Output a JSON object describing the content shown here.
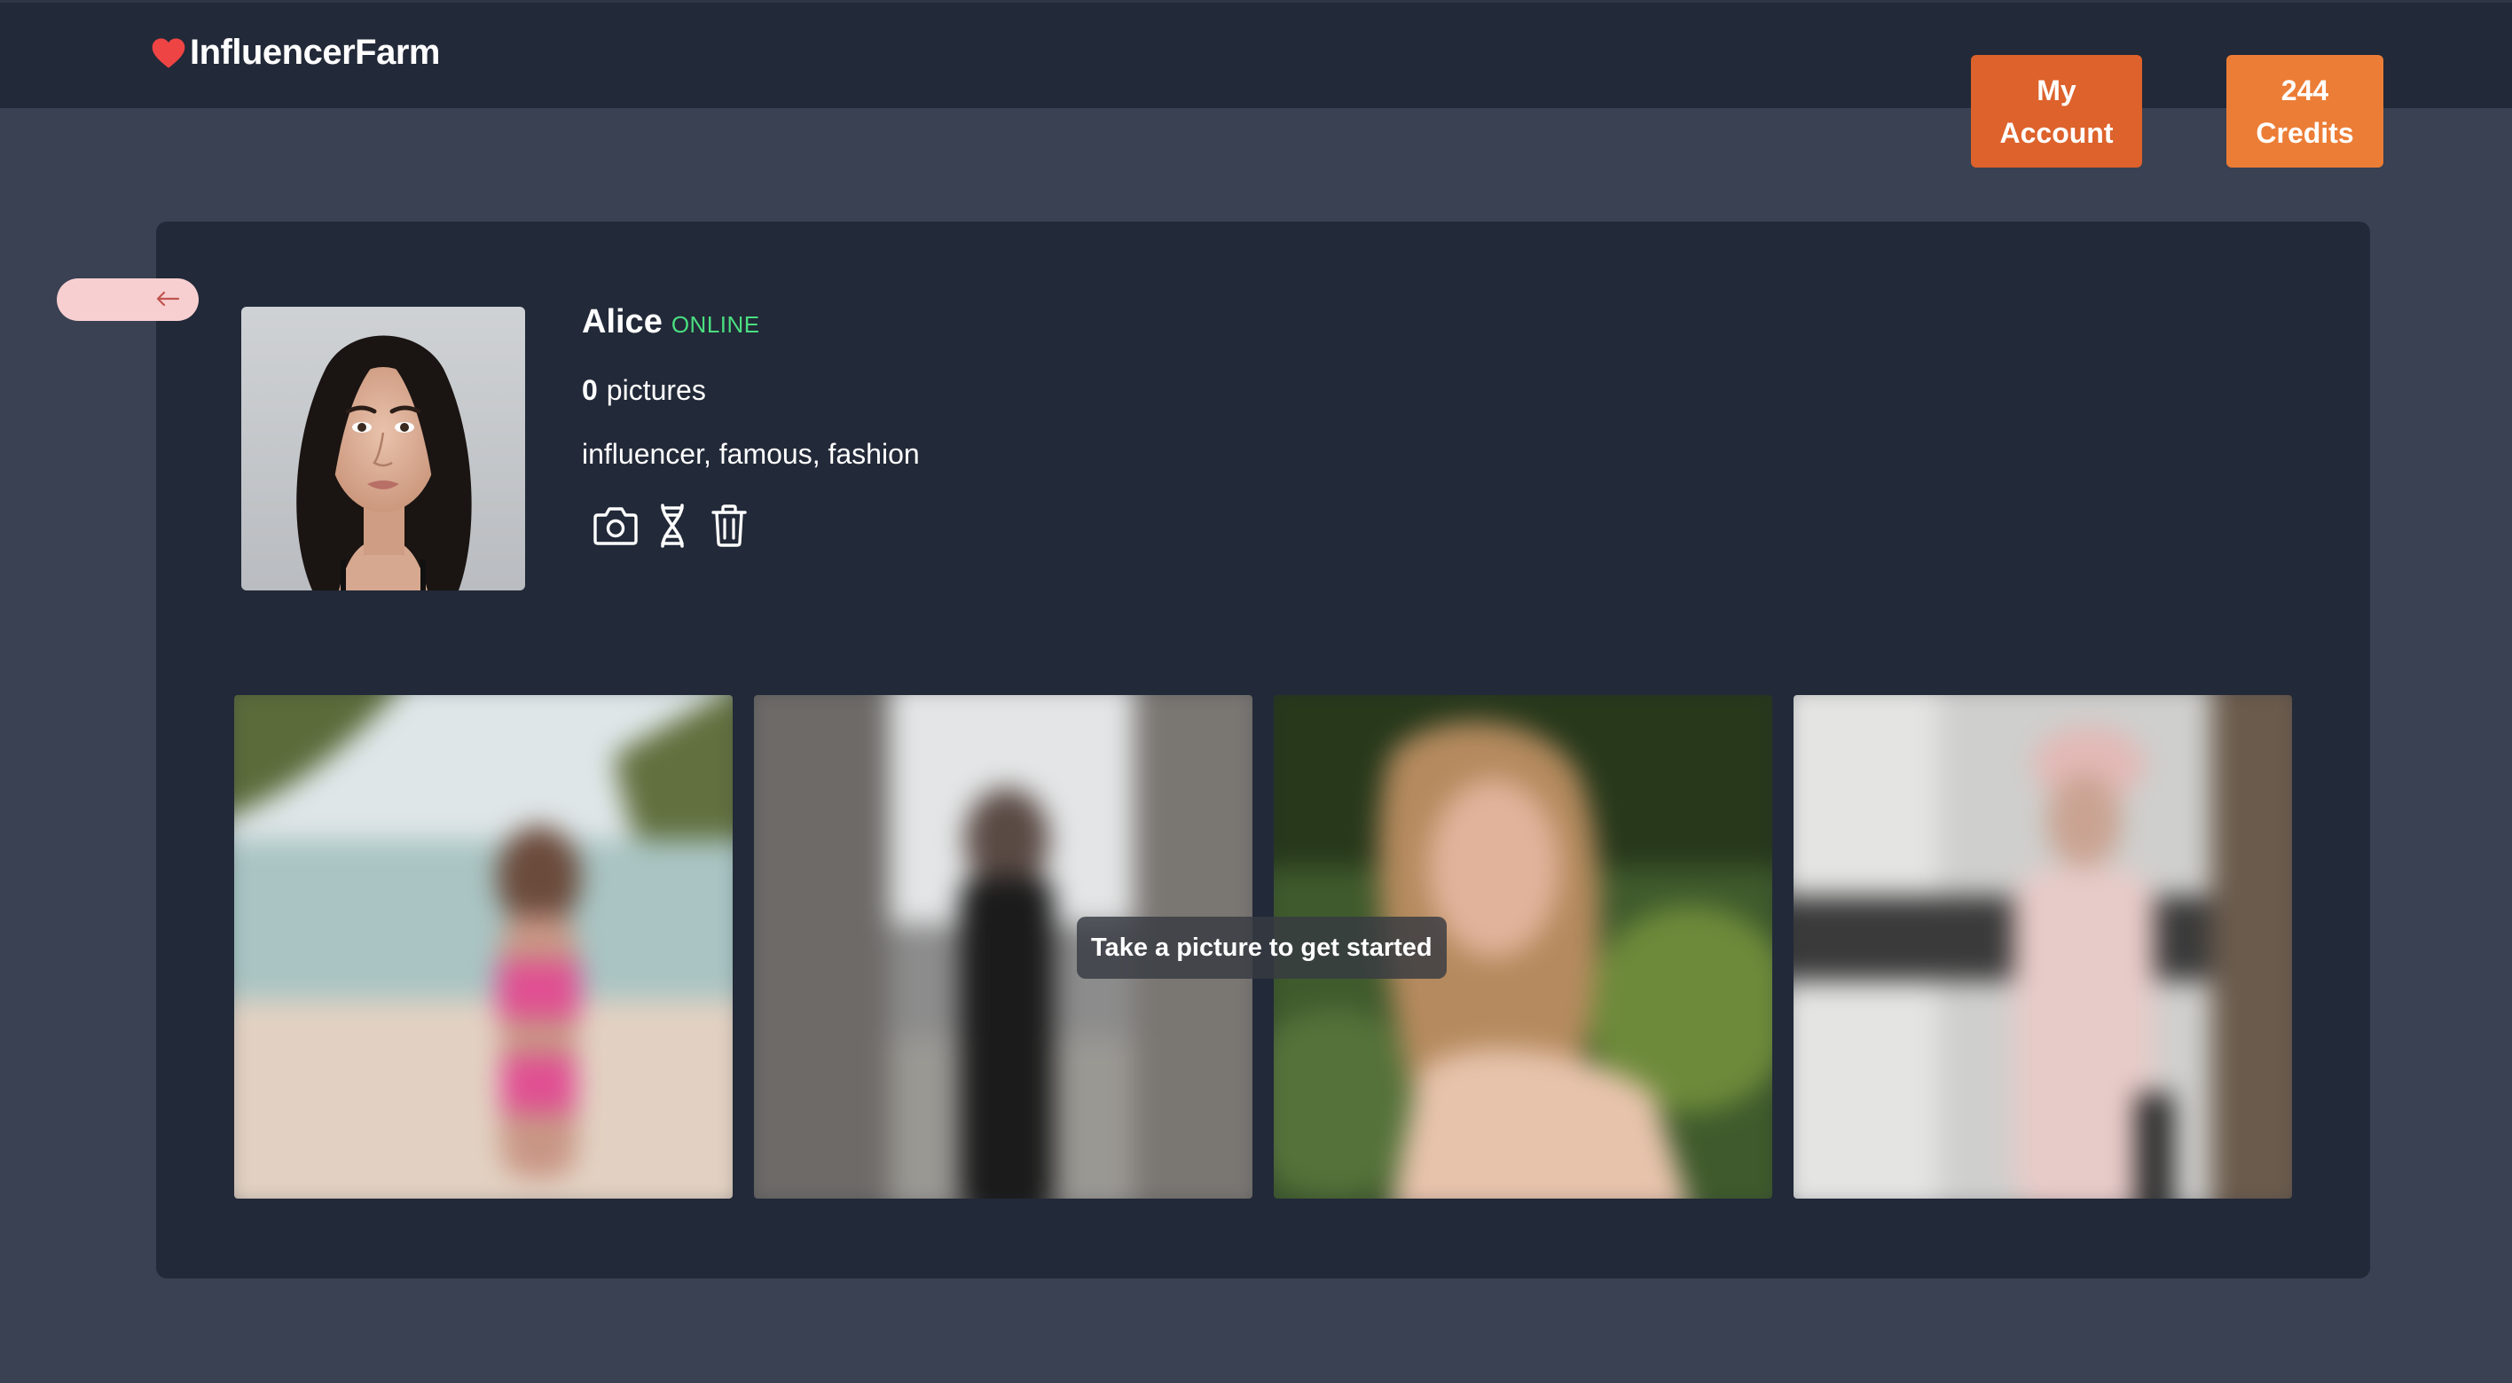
{
  "header": {
    "brand_name": "InfluencerFarm",
    "brand_icon": "heart-icon",
    "account_button": [
      "My",
      "Account"
    ],
    "credits_button": [
      "244",
      "Credits"
    ]
  },
  "back_button": {
    "icon": "arrow-left-icon"
  },
  "profile": {
    "name": "Alice",
    "status": "ONLINE",
    "picture_count": "0",
    "pictures_label": "pictures",
    "tags": "influencer, famous, fashion",
    "actions": [
      {
        "name": "take-picture-button",
        "icon": "camera-icon"
      },
      {
        "name": "dna-button",
        "icon": "dna-icon"
      },
      {
        "name": "delete-button",
        "icon": "trash-icon"
      }
    ]
  },
  "gallery": {
    "message": "Take a picture to get started"
  },
  "colors": {
    "page_bg": "#394152",
    "panel_bg": "#222938",
    "account_button": "#dd622c",
    "credits_button": "#ec7d36",
    "online": "#4ade80",
    "back_button": "#f8cfd0",
    "heart": "#ef4444"
  }
}
